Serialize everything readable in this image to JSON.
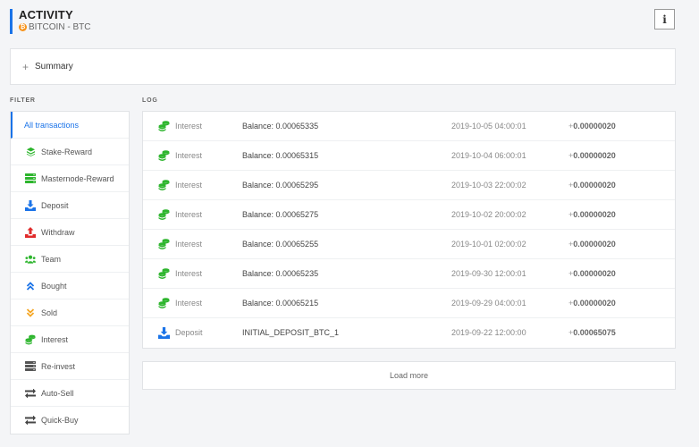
{
  "header": {
    "title": "ACTIVITY",
    "currency_icon_glyph": "₿",
    "subtitle": "BITCOIN - BTC"
  },
  "info_button_label": "i",
  "summary": {
    "plus": "+",
    "label": "Summary"
  },
  "filter": {
    "label": "FILTER",
    "items": [
      {
        "label": "All transactions",
        "icon": "none"
      },
      {
        "label": "Stake-Reward",
        "icon": "coins-icon"
      },
      {
        "label": "Masternode-Reward",
        "icon": "server-icon"
      },
      {
        "label": "Deposit",
        "icon": "download-icon"
      },
      {
        "label": "Withdraw",
        "icon": "upload-icon"
      },
      {
        "label": "Team",
        "icon": "users-icon"
      },
      {
        "label": "Bought",
        "icon": "double-chevron-up-icon"
      },
      {
        "label": "Sold",
        "icon": "double-chevron-down-icon"
      },
      {
        "label": "Interest",
        "icon": "coins-stack-icon"
      },
      {
        "label": "Re-invest",
        "icon": "server-icon"
      },
      {
        "label": "Auto-Sell",
        "icon": "exchange-icon"
      },
      {
        "label": "Quick-Buy",
        "icon": "exchange-icon"
      }
    ]
  },
  "log": {
    "label": "LOG",
    "rows": [
      {
        "type": "Interest",
        "balance": "Balance: 0.00065335",
        "date": "2019-10-05 04:00:01",
        "sign": "+",
        "amount": "0.00000020",
        "icon": "coins-stack-icon"
      },
      {
        "type": "Interest",
        "balance": "Balance: 0.00065315",
        "date": "2019-10-04 06:00:01",
        "sign": "+",
        "amount": "0.00000020",
        "icon": "coins-stack-icon"
      },
      {
        "type": "Interest",
        "balance": "Balance: 0.00065295",
        "date": "2019-10-03 22:00:02",
        "sign": "+",
        "amount": "0.00000020",
        "icon": "coins-stack-icon"
      },
      {
        "type": "Interest",
        "balance": "Balance: 0.00065275",
        "date": "2019-10-02 20:00:02",
        "sign": "+",
        "amount": "0.00000020",
        "icon": "coins-stack-icon"
      },
      {
        "type": "Interest",
        "balance": "Balance: 0.00065255",
        "date": "2019-10-01 02:00:02",
        "sign": "+",
        "amount": "0.00000020",
        "icon": "coins-stack-icon"
      },
      {
        "type": "Interest",
        "balance": "Balance: 0.00065235",
        "date": "2019-09-30 12:00:01",
        "sign": "+",
        "amount": "0.00000020",
        "icon": "coins-stack-icon"
      },
      {
        "type": "Interest",
        "balance": "Balance: 0.00065215",
        "date": "2019-09-29 04:00:01",
        "sign": "+",
        "amount": "0.00000020",
        "icon": "coins-stack-icon"
      },
      {
        "type": "Deposit",
        "balance": "INITIAL_DEPOSIT_BTC_1",
        "date": "2019-09-22 12:00:00",
        "sign": "+",
        "amount": "0.00065075",
        "icon": "download-icon"
      }
    ]
  },
  "load_more_label": "Load more",
  "colors": {
    "accent": "#1a73e8",
    "green": "#2db52d",
    "red": "#e02b2b",
    "orange": "#f5a623",
    "bitcoin": "#f7931a"
  }
}
